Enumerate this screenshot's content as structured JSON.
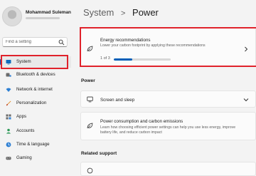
{
  "user": {
    "name": "Mohammad Suleman"
  },
  "search": {
    "placeholder": "Find a setting"
  },
  "sidebar": {
    "items": [
      {
        "label": "System",
        "icon": "system-icon",
        "active": true
      },
      {
        "label": "Bluetooth & devices",
        "icon": "bluetooth-icon"
      },
      {
        "label": "Network & internet",
        "icon": "wifi-icon"
      },
      {
        "label": "Personalization",
        "icon": "brush-icon"
      },
      {
        "label": "Apps",
        "icon": "apps-icon"
      },
      {
        "label": "Accounts",
        "icon": "accounts-icon"
      },
      {
        "label": "Time & language",
        "icon": "time-language-icon"
      },
      {
        "label": "Gaming",
        "icon": "gaming-icon"
      }
    ]
  },
  "breadcrumb": {
    "parent": "System",
    "separator": ">",
    "current": "Power"
  },
  "energy": {
    "title": "Energy recommendations",
    "description": "Lower your carbon footprint by applying these recommendations",
    "progress_text": "1 of 3",
    "progress_fraction": 0.33,
    "icon": "leaf-icon"
  },
  "power_section": {
    "heading": "Power"
  },
  "screen_sleep": {
    "title": "Screen and sleep",
    "icon": "monitor-icon"
  },
  "power_consumption": {
    "title": "Power consumption and carbon emissions",
    "description": "Learn how choosing efficient power settings can help you use less energy, improve battery life, and reduce carbon impact",
    "icon": "leaf-icon"
  },
  "related": {
    "heading": "Related support"
  },
  "colors": {
    "accent": "#005fb8",
    "highlight": "#e0222b",
    "background": "#f3f3f3"
  }
}
